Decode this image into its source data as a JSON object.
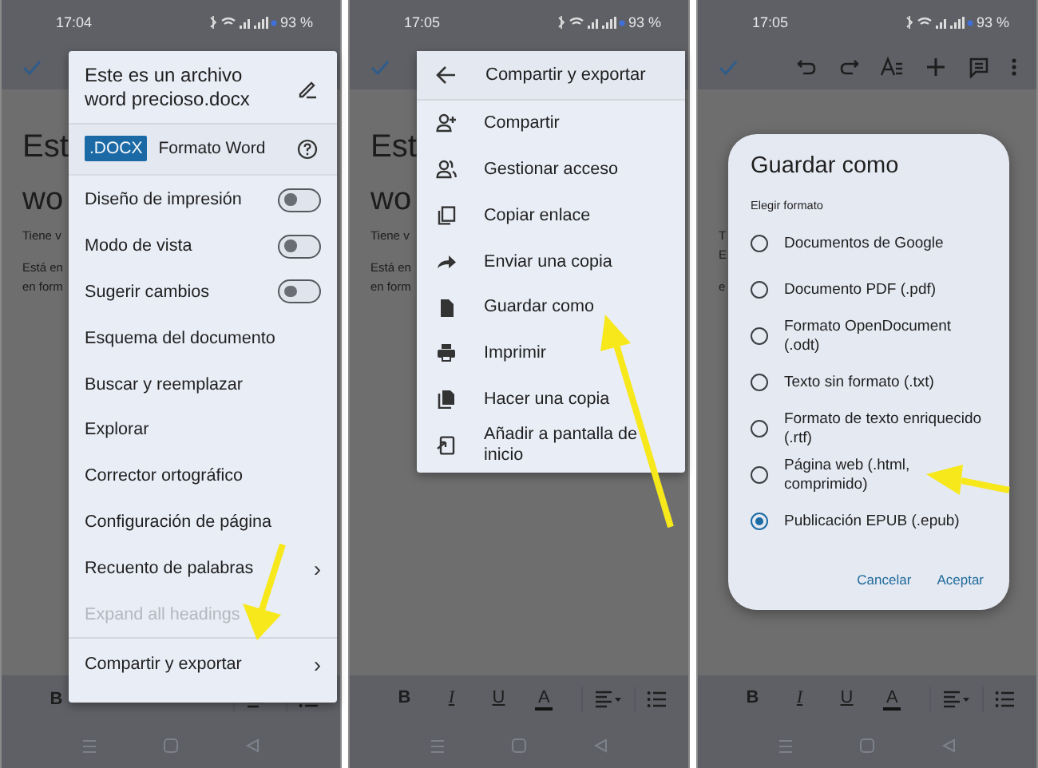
{
  "phones": [
    {
      "status": {
        "time": "17:04",
        "battery": "93 %"
      },
      "document": [
        {
          "kind": "title",
          "text": "Est"
        },
        {
          "kind": "title",
          "text": "wo"
        },
        {
          "kind": "small",
          "text": "Tiene v"
        },
        {
          "kind": "small",
          "text": "Está en"
        },
        {
          "kind": "small",
          "text": "en form"
        }
      ],
      "overlay": {
        "kind": "menu",
        "title": "Este es un archivo word precioso.docx",
        "badge": ".DOCX",
        "format": "Formato Word",
        "sections": [
          [
            {
              "label": "Diseño de impresión",
              "kind": "toggle",
              "on": false
            },
            {
              "label": "Modo de vista",
              "kind": "toggle",
              "on": false
            },
            {
              "label": "Sugerir cambios",
              "kind": "toggle",
              "on": false
            },
            {
              "label": "Esquema del documento",
              "kind": "plain"
            },
            {
              "label": "Buscar y reemplazar",
              "kind": "plain"
            },
            {
              "label": "Explorar",
              "kind": "plain"
            },
            {
              "label": "Corrector ortográfico",
              "kind": "plain"
            },
            {
              "label": "Configuración de página",
              "kind": "plain"
            },
            {
              "label": "Recuento de palabras",
              "kind": "submenu",
              "chevron": "›"
            },
            {
              "label": "Expand all headings",
              "kind": "plain",
              "disabled": true
            }
          ],
          [
            {
              "label": "Compartir y exportar",
              "kind": "submenu",
              "chevron": "›"
            }
          ]
        ]
      },
      "format_bar": [
        "B"
      ]
    },
    {
      "status": {
        "time": "17:05",
        "battery": "93 %"
      },
      "document": [
        {
          "kind": "title",
          "text": "Est"
        },
        {
          "kind": "title",
          "text": "wo"
        },
        {
          "kind": "small",
          "text": "Tiene v"
        },
        {
          "kind": "small",
          "text": "Está en"
        },
        {
          "kind": "small",
          "text": "en form"
        }
      ],
      "overlay": {
        "kind": "submenu",
        "title": "Compartir y exportar",
        "items": [
          "Compartir",
          "Gestionar acceso",
          "Copiar enlace",
          "Enviar una copia",
          "Guardar como",
          "Imprimir",
          "Hacer una copia",
          "Añadir a pantalla de inicio"
        ]
      },
      "format_bar": [
        "B",
        "I",
        "U",
        "A"
      ]
    },
    {
      "status": {
        "time": "17:05",
        "battery": "93 %"
      },
      "document": [
        {
          "kind": "spacer"
        },
        {
          "kind": "small",
          "text": "T"
        },
        {
          "kind": "small",
          "text": "E"
        },
        {
          "kind": "small",
          "text": "e"
        }
      ],
      "overlay": {
        "kind": "dialog",
        "title": "Guardar como",
        "subtitle": "Elegir formato",
        "options": [
          {
            "label": "Documentos de Google",
            "selected": false
          },
          {
            "label": "Documento PDF (.pdf)",
            "selected": false
          },
          {
            "label": "Formato OpenDocument (.odt)",
            "selected": false
          },
          {
            "label": "Texto sin formato (.txt)",
            "selected": false
          },
          {
            "label": "Formato de texto enriquecido (.rtf)",
            "selected": false
          },
          {
            "label": "Página web (.html, comprimido)",
            "selected": false
          },
          {
            "label": "Publicación EPUB (.epub)",
            "selected": true
          }
        ],
        "buttons": [
          "Cancelar",
          "Aceptar"
        ]
      },
      "format_bar": [
        "B",
        "I",
        "U",
        "A"
      ]
    }
  ]
}
